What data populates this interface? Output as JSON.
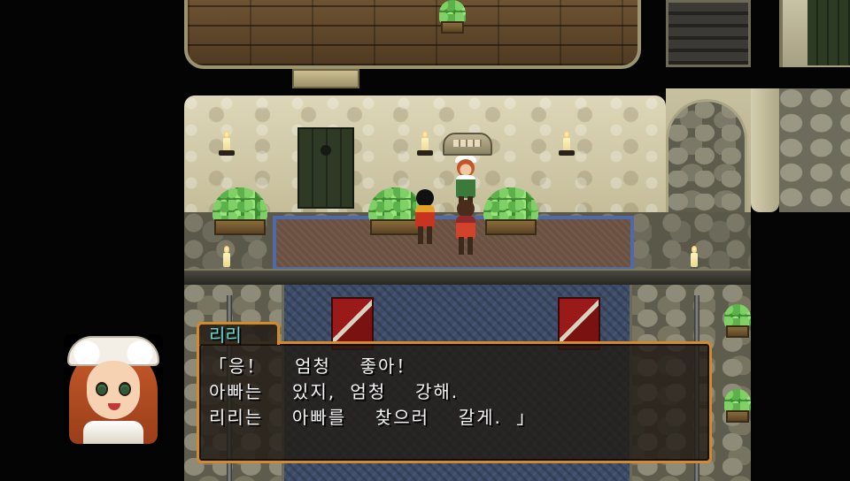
{
  "dialogue": {
    "speaker": "리리",
    "lines": [
      "「응！  엄청  좋아！",
      "아빠는  있지, 엄청  강해.",
      "리리는  아빠를  찾으러  갈게. 」"
    ]
  },
  "portrait": {
    "character": "Lili",
    "expression": "smiling"
  },
  "colors": {
    "dialogue_border": "#d58a2a",
    "speaker_name": "#5ed6d2",
    "dialogue_text": "#f2f2f2"
  }
}
